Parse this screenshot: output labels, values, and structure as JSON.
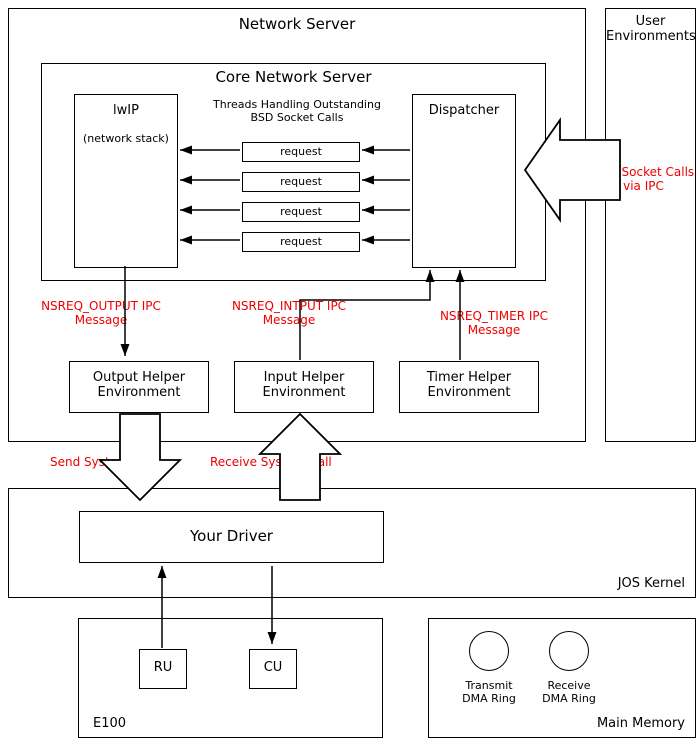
{
  "diagram": {
    "network_server": {
      "title": "Network Server",
      "core": {
        "title": "Core Network Server",
        "lwip": {
          "title": "lwIP",
          "subtitle": "(network stack)"
        },
        "threads_label": "Threads Handling Outstanding\nBSD Socket Calls",
        "requests": [
          "request",
          "request",
          "request",
          "request"
        ],
        "dispatcher": {
          "title": "Dispatcher"
        }
      },
      "ipc_messages": {
        "output": "NSREQ_OUTPUT IPC\nMessage",
        "input": "NSREQ_INTPUT IPC\nMessage",
        "timer": "NSREQ_TIMER IPC\nMessage"
      },
      "helpers": {
        "output": "Output Helper\nEnvironment",
        "input": "Input Helper\nEnvironment",
        "timer": "Timer Helper\nEnvironment"
      }
    },
    "user_env": "User\nEnvironments",
    "bsd_arrow": "BSD Socket Calls\nvia IPC",
    "syscalls": {
      "send": "Send System Call",
      "receive": "Receive System Call"
    },
    "kernel": {
      "title": "JOS Kernel",
      "driver": "Your Driver"
    },
    "e100": {
      "title": "E100",
      "ru": "RU",
      "cu": "CU"
    },
    "memory": {
      "title": "Main Memory",
      "tx": "Transmit\nDMA Ring",
      "rx": "Receive\nDMA Ring"
    }
  }
}
